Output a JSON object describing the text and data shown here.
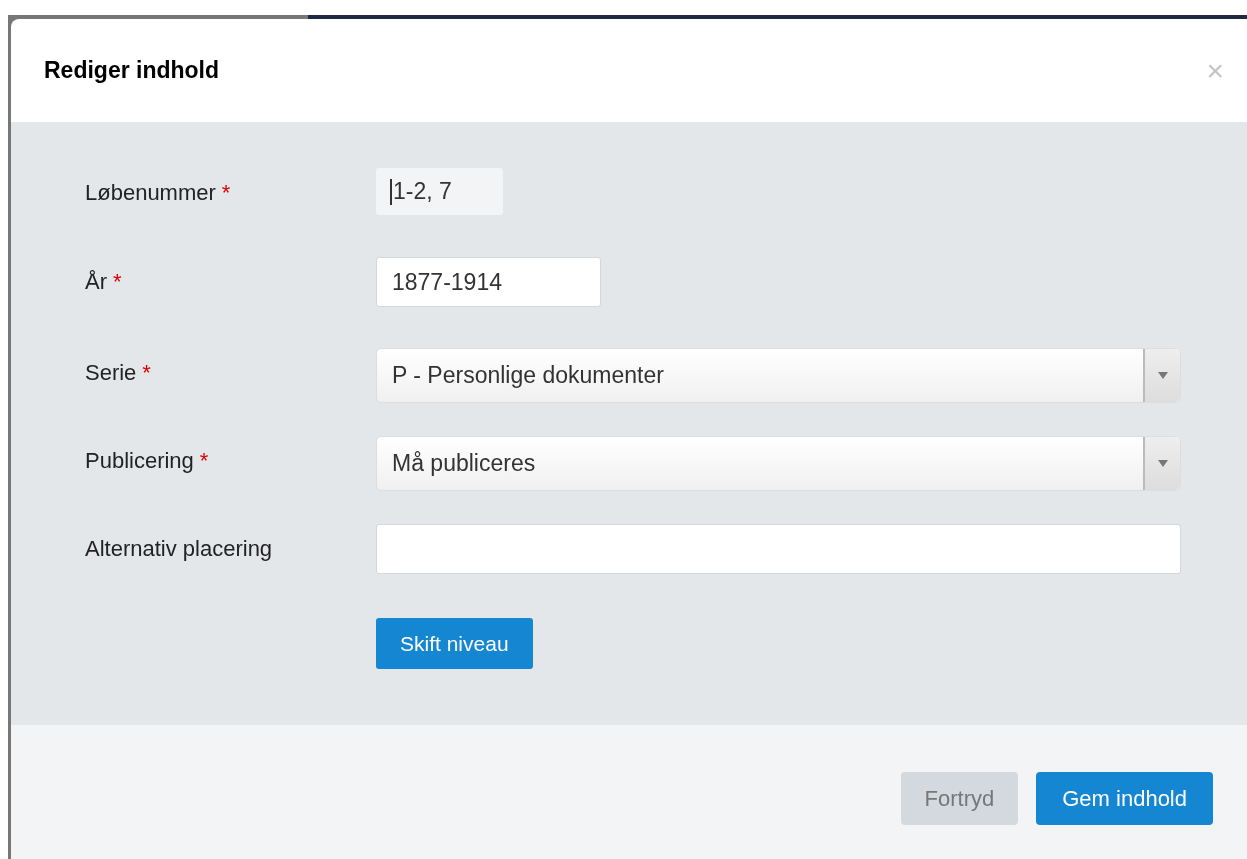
{
  "dialog": {
    "title": "Rediger indhold",
    "close": "×"
  },
  "fields": [
    {
      "label": "Løbenummer",
      "required": true,
      "kind": "readonly",
      "value": "1-2, 7"
    },
    {
      "label": "År",
      "required": true,
      "kind": "text",
      "value": "1877-1914"
    },
    {
      "label": "Serie",
      "required": true,
      "kind": "select",
      "value": "P - Personlige dokumenter"
    },
    {
      "label": "Publicering",
      "required": true,
      "kind": "select",
      "value": "Må publiceres"
    },
    {
      "label": "Alternativ placering",
      "required": false,
      "kind": "text"
    }
  ],
  "required_mark": "*",
  "level_button": "Skift niveau",
  "buttons": [
    {
      "label": "Fortryd",
      "kind": "secondary"
    },
    {
      "label": "Gem indhold",
      "kind": "primary"
    }
  ]
}
